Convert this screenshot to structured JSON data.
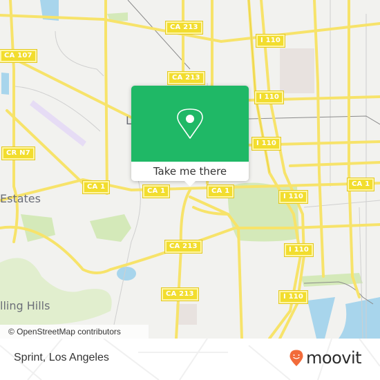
{
  "popup": {
    "button_label": "Take me there",
    "icon": "map-pin-icon",
    "accent_color": "#1fb866"
  },
  "map": {
    "attribution": "© OpenStreetMap contributors",
    "place_labels": [
      {
        "id": "estates",
        "text": "Estates"
      },
      {
        "id": "rolling-hills",
        "text": "lling Hills"
      },
      {
        "id": "l-label",
        "text": "L"
      }
    ],
    "road_shields": [
      {
        "id": "ca213-top",
        "text": "CA 213"
      },
      {
        "id": "ca107",
        "text": "CA 107"
      },
      {
        "id": "i110-top",
        "text": "I 110"
      },
      {
        "id": "ca213-mid",
        "text": "CA 213"
      },
      {
        "id": "i110-mid",
        "text": "I 110"
      },
      {
        "id": "crn7",
        "text": "CR N7"
      },
      {
        "id": "i110-lower",
        "text": "I 110"
      },
      {
        "id": "ca1-left",
        "text": "CA 1"
      },
      {
        "id": "ca1-center",
        "text": "CA 1"
      },
      {
        "id": "ca1-right",
        "text": "CA 1"
      },
      {
        "id": "ca1-far-right",
        "text": "CA 1"
      },
      {
        "id": "i110-east",
        "text": "I 110"
      },
      {
        "id": "ca213-south",
        "text": "CA 213"
      },
      {
        "id": "i110-south",
        "text": "I 110"
      },
      {
        "id": "ca213-bottom",
        "text": "CA 213"
      },
      {
        "id": "i110-bottom",
        "text": "I 110"
      }
    ]
  },
  "footer": {
    "title": "Sprint, Los Angeles",
    "brand": "moovit",
    "brand_color": "#f26b3a"
  }
}
